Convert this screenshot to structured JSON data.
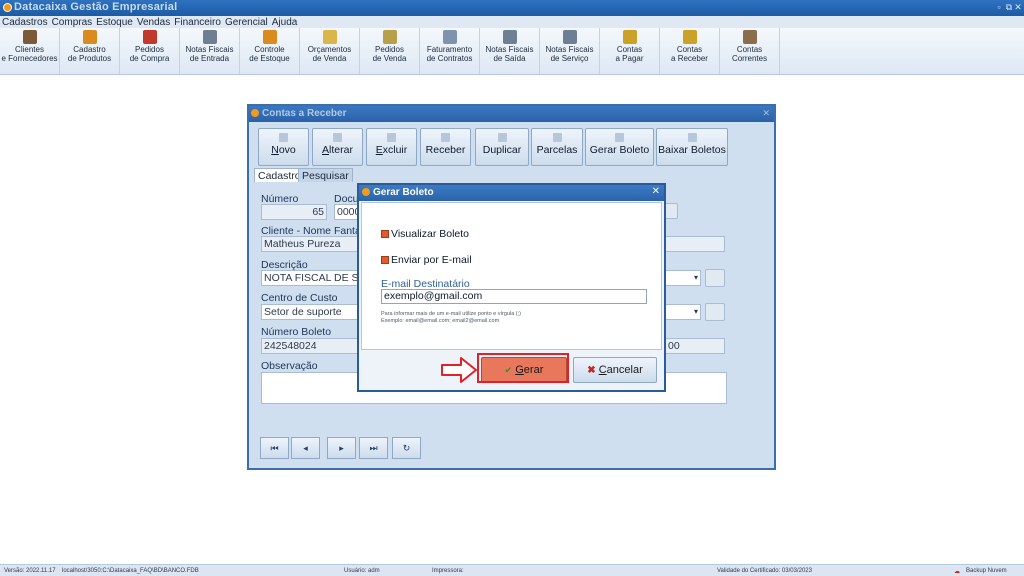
{
  "app": {
    "title": "Datacaixa Gestão Empresarial",
    "restore_glyph": "▫",
    "maximize_glyph": "⧉",
    "close_glyph": "✕"
  },
  "menu": [
    "Cadastros",
    "Compras",
    "Estoque",
    "Vendas",
    "Financeiro",
    "Gerencial",
    "Ajuda"
  ],
  "toolbar": [
    {
      "label": "Clientes\ne Fornecedores",
      "icon": "people-icon",
      "color": "#7b5a3a"
    },
    {
      "label": "Cadastro\nde Produtos",
      "icon": "boxes-icon",
      "color": "#d98b1e"
    },
    {
      "label": "Pedidos\nde Compra",
      "icon": "order-book-icon",
      "color": "#c0392b"
    },
    {
      "label": "Notas Fiscais\nde Entrada",
      "icon": "invoice-in-icon",
      "color": "#6e7f93"
    },
    {
      "label": "Controle\nde Estoque",
      "icon": "stock-boxes-icon",
      "color": "#d98b1e"
    },
    {
      "label": "Orçamentos\nde Venda",
      "icon": "quote-doc-icon",
      "color": "#d8b64a"
    },
    {
      "label": "Pedidos\nde Venda",
      "icon": "sales-order-icon",
      "color": "#b8a04a"
    },
    {
      "label": "Faturamento\nde Contratos",
      "icon": "contract-doc-icon",
      "color": "#7f93ad"
    },
    {
      "label": "Notas Fiscais\nde Saída",
      "icon": "invoice-out-icon",
      "color": "#6e7f93"
    },
    {
      "label": "Notas Fiscais\nde Serviço",
      "icon": "invoice-service-icon",
      "color": "#6e7f93"
    },
    {
      "label": "Contas\na Pagar",
      "icon": "pay-icon",
      "color": "#c9a227"
    },
    {
      "label": "Contas\na Receber",
      "icon": "receive-icon",
      "color": "#c9a227"
    },
    {
      "label": "Contas\nCorrentes",
      "icon": "bank-icon",
      "color": "#8a6d4a"
    }
  ],
  "contas_receber": {
    "title": "Contas a Receber",
    "actions": [
      {
        "label": "Novo",
        "underline": "N",
        "rest": "ovo"
      },
      {
        "label": "Alterar",
        "underline": "A",
        "rest": "lterar"
      },
      {
        "label": "Excluir",
        "underline": "E",
        "rest": "xcluir"
      },
      {
        "label": "Receber",
        "underline": "",
        "rest": "Receber"
      },
      {
        "label": "Duplicar",
        "underline": "",
        "rest": "Duplicar"
      },
      {
        "label": "Parcelas",
        "underline": "",
        "rest": "Parcelas"
      },
      {
        "label": "Gerar Boleto",
        "underline": "",
        "rest": "Gerar Boleto"
      },
      {
        "label": "Baixar Boletos",
        "underline": "",
        "rest": "Baixar Boletos"
      }
    ],
    "tabs": [
      "Cadastro",
      "Pesquisar"
    ],
    "fields": {
      "numero_label": "Número",
      "numero_value": "65",
      "documento_label": "Docu",
      "documento_value": "0000",
      "cliente_label": "Cliente - Nome Fantas",
      "cliente_value": "Matheus Pureza",
      "descricao_label": "Descrição",
      "descricao_value": "NOTA FISCAL DE SER",
      "centro_label": "Centro de Custo",
      "centro_value": "Setor de suporte",
      "boleto_label": "Número Boleto",
      "boleto_value": "242548024",
      "obs_label": "Observação",
      "right_value": "00"
    },
    "nav": [
      "⏮",
      "◂",
      "▸",
      "⏭",
      "↻"
    ]
  },
  "dialog": {
    "title": "Gerar Boleto",
    "visualizar_label": "Visualizar Boleto",
    "enviar_label": "Enviar por E-mail",
    "email_label": "E-mail Destinatário",
    "email_value": "exemplo@gmail.com",
    "hint1": "Para informar mais de um e-mail utilize ponto e vírgula (;)",
    "hint2": "Exemplo: email@email.com; email2@email.com",
    "gerar_label": "Gerar",
    "gerar_underline": "G",
    "gerar_rest": "erar",
    "cancelar_underline": "C",
    "cancelar_rest": "ancelar",
    "check_glyph": "✔",
    "cancel_glyph": "✖",
    "close_glyph": "✕"
  },
  "status": {
    "versao": "Versão: 2022.11.17",
    "banco": "localhost/3050:C:\\Datacaixa_FAQ\\BD\\BANCO.FDB",
    "usuario": "Usuário: adm",
    "impressora": "Impressora:",
    "certificado": "Validade do Certificado: 03/03/2023",
    "backup": "Backup Nuvem"
  },
  "colors": {
    "accent": "#2b5c9a",
    "highlight": "#e0212a",
    "gerar_button": "#e8775b"
  }
}
